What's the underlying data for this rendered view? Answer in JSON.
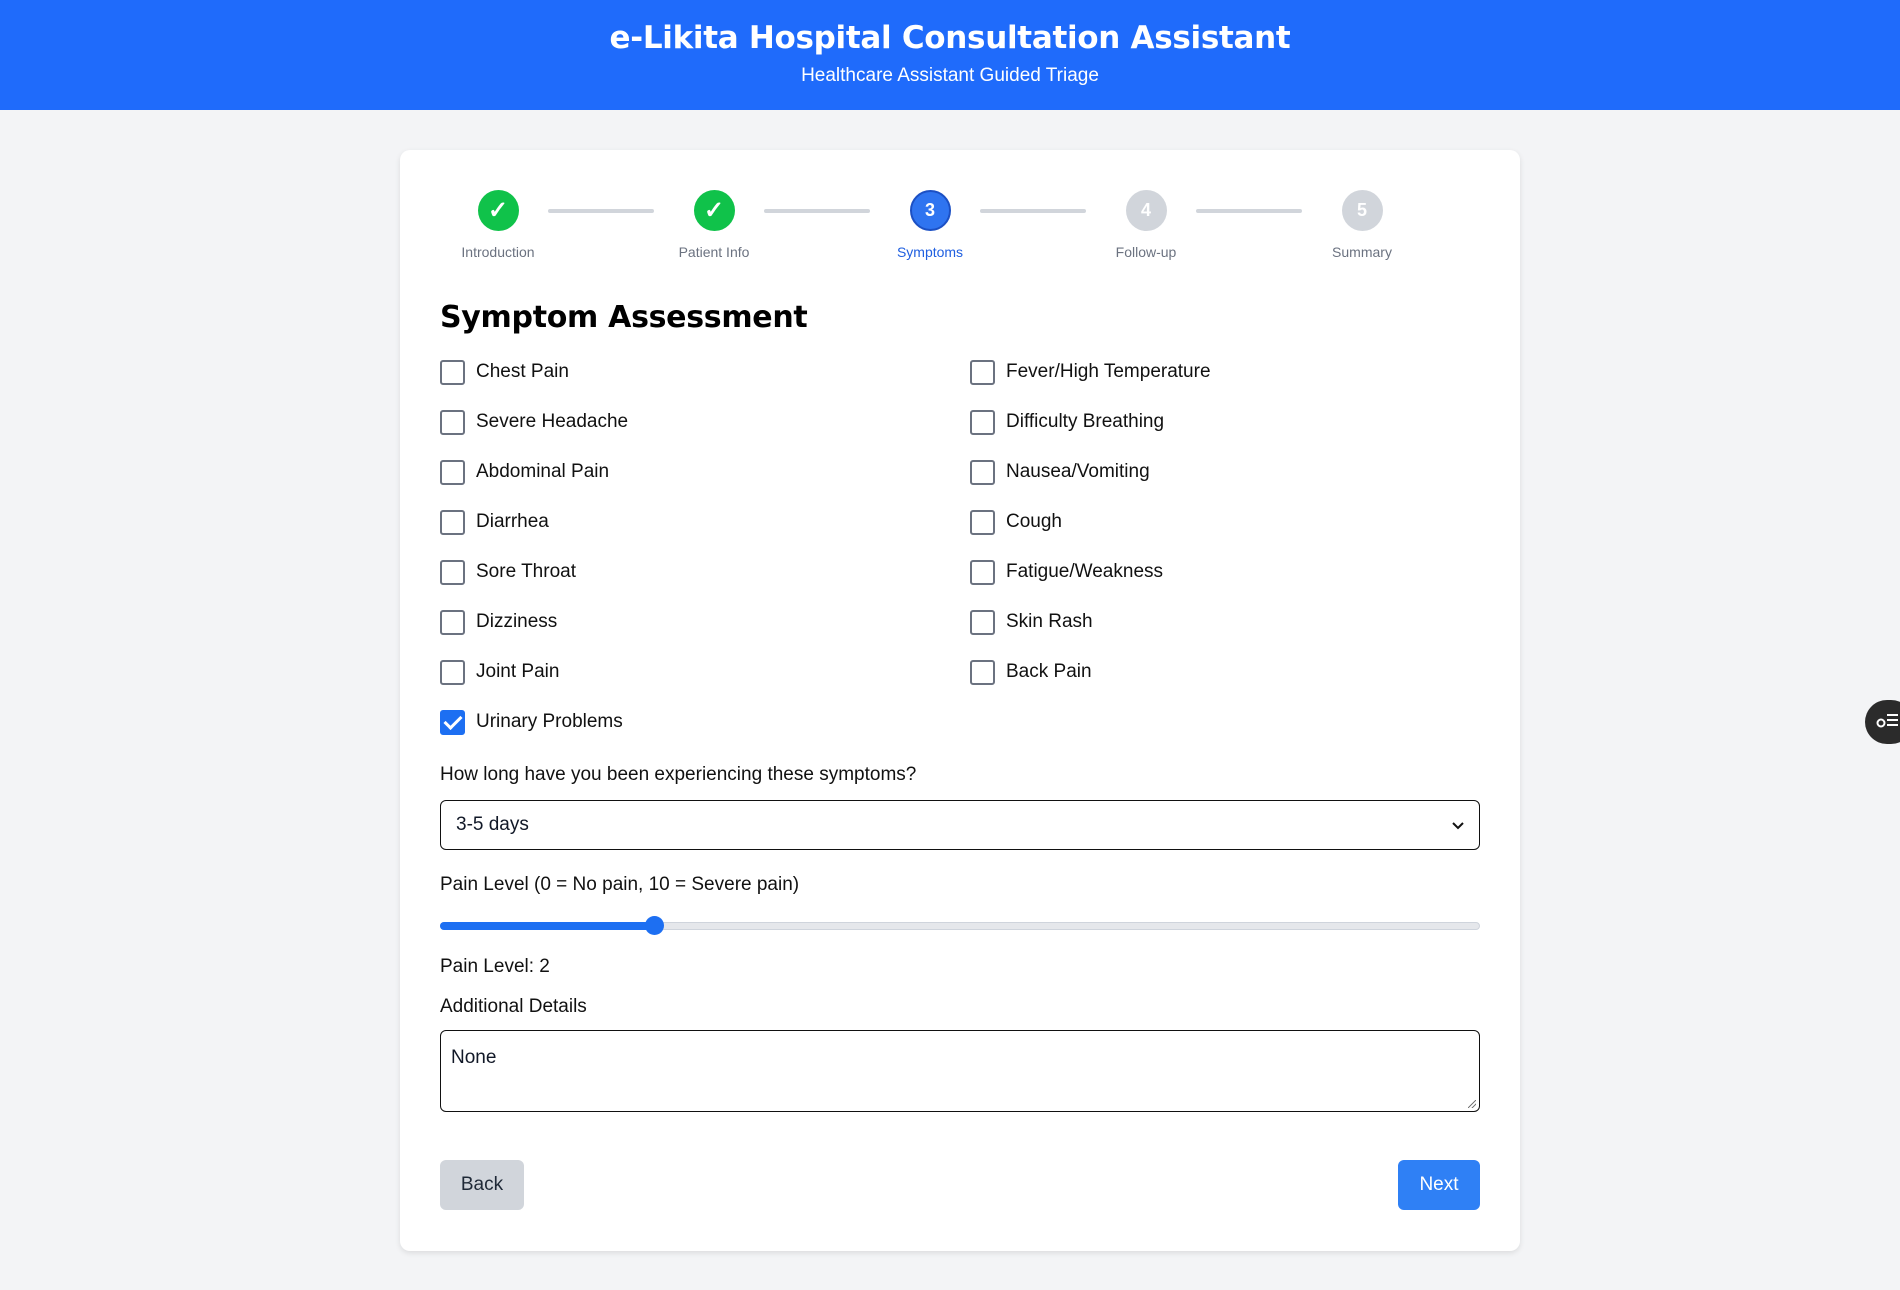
{
  "header": {
    "title": "e-Likita Hospital Consultation Assistant",
    "subtitle": "Healthcare Assistant Guided Triage"
  },
  "stepper": {
    "steps": [
      {
        "label": "Introduction",
        "number": "1",
        "status": "done"
      },
      {
        "label": "Patient Info",
        "number": "2",
        "status": "done"
      },
      {
        "label": "Symptoms",
        "number": "3",
        "status": "active"
      },
      {
        "label": "Follow-up",
        "number": "4",
        "status": "todo"
      },
      {
        "label": "Summary",
        "number": "5",
        "status": "todo"
      }
    ],
    "done_mark": "✓"
  },
  "section_title": "Symptom Assessment",
  "symptoms": [
    {
      "label": "Chest Pain",
      "checked": false
    },
    {
      "label": "Fever/High Temperature",
      "checked": false
    },
    {
      "label": "Severe Headache",
      "checked": false
    },
    {
      "label": "Difficulty Breathing",
      "checked": false
    },
    {
      "label": "Abdominal Pain",
      "checked": false
    },
    {
      "label": "Nausea/Vomiting",
      "checked": false
    },
    {
      "label": "Diarrhea",
      "checked": false
    },
    {
      "label": "Cough",
      "checked": false
    },
    {
      "label": "Sore Throat",
      "checked": false
    },
    {
      "label": "Fatigue/Weakness",
      "checked": false
    },
    {
      "label": "Dizziness",
      "checked": false
    },
    {
      "label": "Skin Rash",
      "checked": false
    },
    {
      "label": "Joint Pain",
      "checked": false
    },
    {
      "label": "Back Pain",
      "checked": false
    },
    {
      "label": "Urinary Problems",
      "checked": true
    }
  ],
  "duration": {
    "label": "How long have you been experiencing these symptoms?",
    "value": "3-5 days"
  },
  "pain": {
    "label": "Pain Level (0 = No pain, 10 = Severe pain)",
    "min": 0,
    "max": 10,
    "value": 2,
    "readout": "Pain Level: 2"
  },
  "details": {
    "label": "Additional Details",
    "value": "None"
  },
  "buttons": {
    "back": "Back",
    "next": "Next"
  },
  "colors": {
    "primary": "#1f6bfb",
    "done": "#10c24a",
    "accent": "#1d6ff2"
  }
}
